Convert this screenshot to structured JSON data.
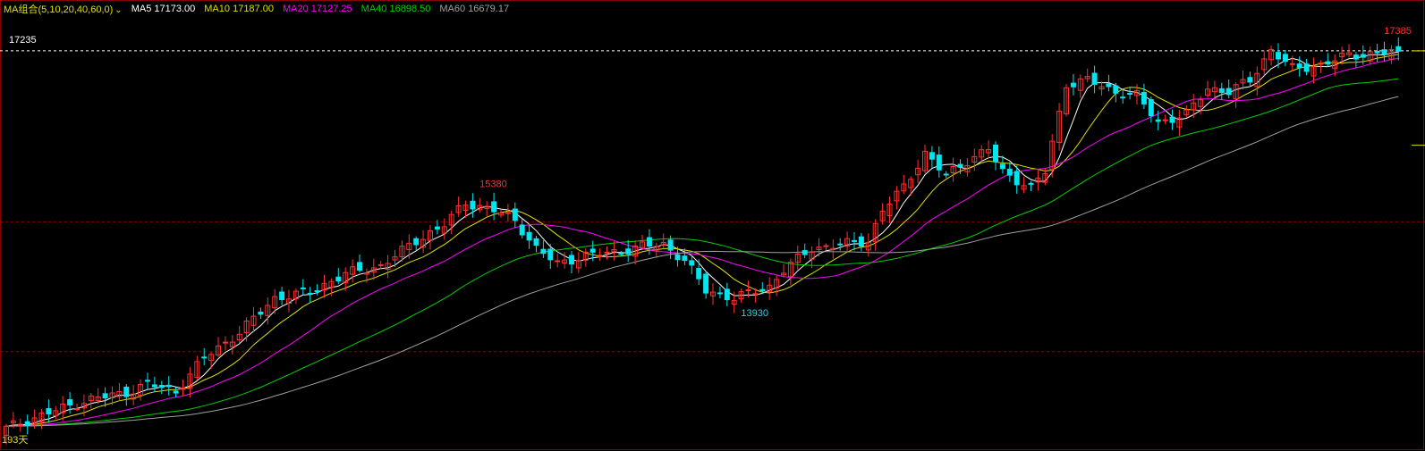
{
  "legend": {
    "combo_label": "MA组合(5,10,20,40,60,0)",
    "ma5": {
      "label": "MA5",
      "value": "17173.00",
      "color": "#ffffff"
    },
    "ma10": {
      "label": "MA10",
      "value": "17187.00",
      "color": "#e0e000"
    },
    "ma20": {
      "label": "MA20",
      "value": "17127.25",
      "color": "#ff00ff"
    },
    "ma40": {
      "label": "MA40",
      "value": "16898.50",
      "color": "#00d000"
    },
    "ma60": {
      "label": "MA60",
      "value": "16679.17",
      "color": "#a0a0a0"
    }
  },
  "price_line_label": "17235",
  "days_label": "193天",
  "colors": {
    "up": "#ff3030",
    "down": "#00e5ee",
    "background": "#000000",
    "grid": "#8b0000",
    "price_line": "#ffffff"
  },
  "chart_data": {
    "type": "candlestick",
    "ylim": [
      12000,
      17900
    ],
    "current_price": 17235,
    "annotations": [
      {
        "text": "15380",
        "value": 15380,
        "kind": "high"
      },
      {
        "text": "13930",
        "value": 13930,
        "kind": "low"
      },
      {
        "text": "17385",
        "value": 17385,
        "kind": "high"
      }
    ],
    "anchors": [
      [
        0,
        12300
      ],
      [
        6,
        12500
      ],
      [
        12,
        12680
      ],
      [
        17,
        12760
      ],
      [
        20,
        12880
      ],
      [
        24,
        12780
      ],
      [
        28,
        13220
      ],
      [
        33,
        13550
      ],
      [
        38,
        14000
      ],
      [
        43,
        14080
      ],
      [
        48,
        14320
      ],
      [
        53,
        14420
      ],
      [
        58,
        14750
      ],
      [
        62,
        14960
      ],
      [
        65,
        15250
      ],
      [
        69,
        15150
      ],
      [
        72,
        15020
      ],
      [
        75,
        14650
      ],
      [
        78,
        14450
      ],
      [
        82,
        14560
      ],
      [
        86,
        14600
      ],
      [
        90,
        14680
      ],
      [
        93,
        14700
      ],
      [
        96,
        14500
      ],
      [
        99,
        14100
      ],
      [
        103,
        14000
      ],
      [
        108,
        14150
      ],
      [
        110,
        14370
      ],
      [
        114,
        14650
      ],
      [
        118,
        14700
      ],
      [
        122,
        14750
      ],
      [
        124,
        15150
      ],
      [
        127,
        15450
      ],
      [
        130,
        15900
      ],
      [
        133,
        15600
      ],
      [
        136,
        15800
      ],
      [
        139,
        15950
      ],
      [
        141,
        15650
      ],
      [
        145,
        15450
      ],
      [
        147,
        15650
      ],
      [
        150,
        16800
      ],
      [
        153,
        16850
      ],
      [
        157,
        16700
      ],
      [
        160,
        16650
      ],
      [
        163,
        16300
      ],
      [
        167,
        16400
      ],
      [
        170,
        16750
      ],
      [
        173,
        16700
      ],
      [
        176,
        16850
      ],
      [
        179,
        17250
      ],
      [
        182,
        17000
      ],
      [
        186,
        17050
      ],
      [
        190,
        17180
      ],
      [
        194,
        17200
      ],
      [
        197,
        17230
      ]
    ],
    "series": [
      {
        "name": "MA5",
        "period": 5
      },
      {
        "name": "MA10",
        "period": 10
      },
      {
        "name": "MA20",
        "period": 20
      },
      {
        "name": "MA40",
        "period": 40
      },
      {
        "name": "MA60",
        "period": 60
      }
    ]
  }
}
